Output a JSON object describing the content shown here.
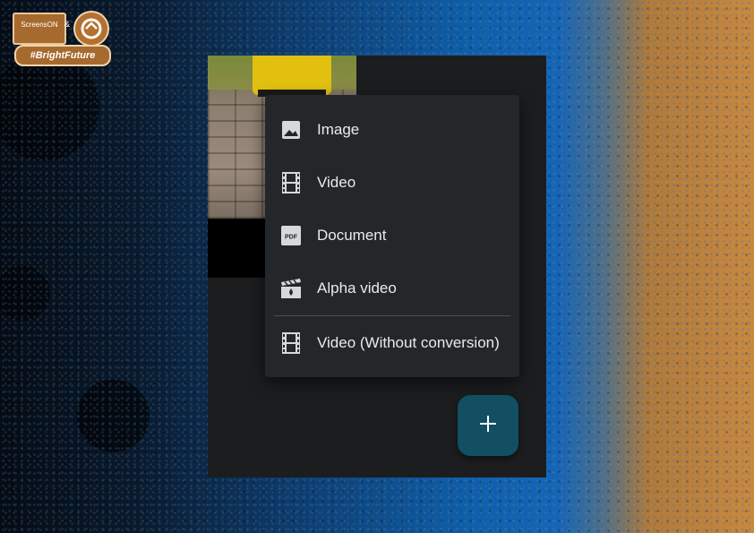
{
  "logo": {
    "brand": "ScreensON",
    "ampersand": "&",
    "tagline": "#BrightFuture"
  },
  "menu": {
    "items": [
      {
        "label": "Image",
        "icon": "image-icon"
      },
      {
        "label": "Video",
        "icon": "film-icon"
      },
      {
        "label": "Document",
        "icon": "pdf-icon"
      },
      {
        "label": "Alpha video",
        "icon": "clapperboard-icon"
      },
      {
        "label": "Video (Without conversion)",
        "icon": "film-icon"
      }
    ]
  },
  "fab": {
    "symbol": "+",
    "icon": "plus-icon"
  },
  "colors": {
    "panel": "#1b1d1f",
    "menu": "#24272a",
    "fab": "#124f62",
    "text": "#e8eaed"
  }
}
